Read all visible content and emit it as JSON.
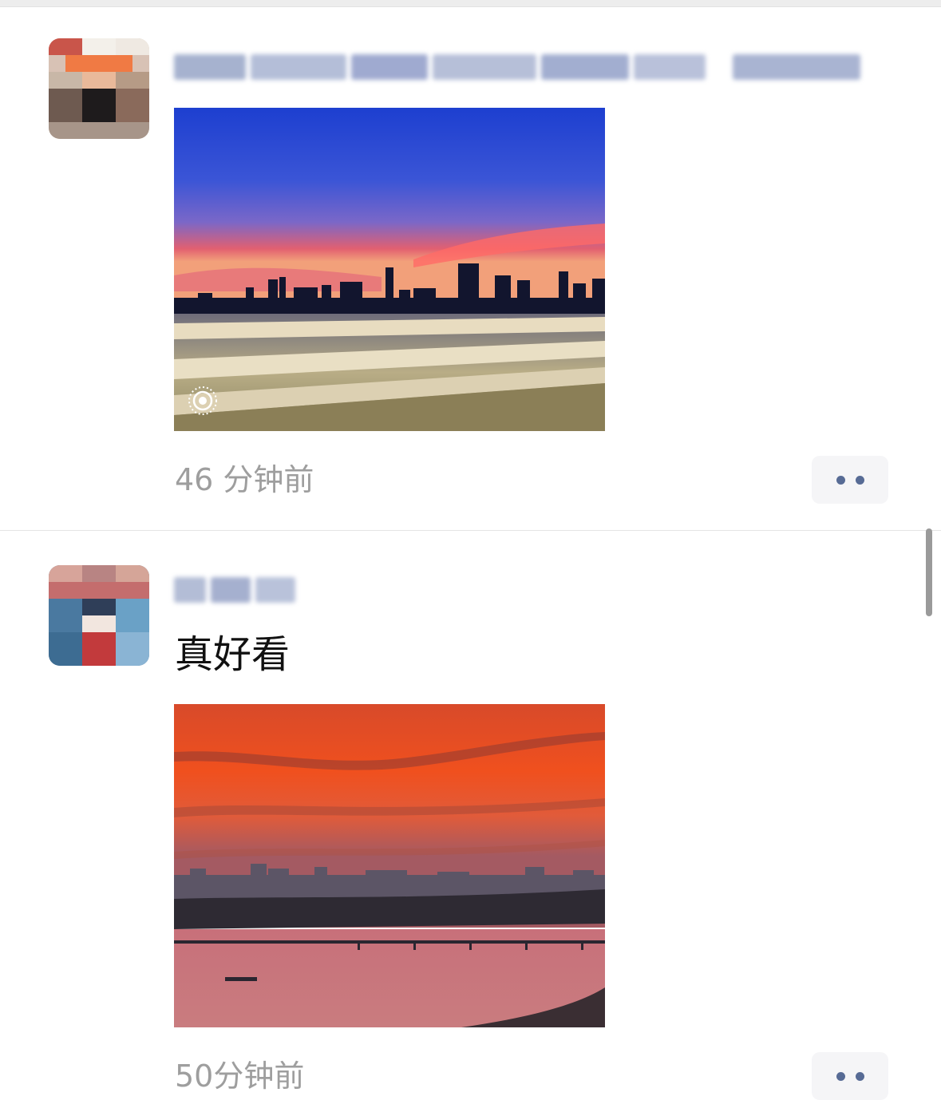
{
  "feed": {
    "posts": [
      {
        "caption": "",
        "photo_alt": "",
        "live_photo_icon": "live-photo-icon",
        "timestamp": "46 分钟前",
        "more_icon": "more-dots-icon"
      },
      {
        "caption": "真好看",
        "photo_alt": "",
        "timestamp": "50分钟前",
        "more_icon": "more-dots-icon"
      }
    ]
  },
  "colors": {
    "link_blue": "#576b95",
    "timestamp_gray": "#9e9e9e",
    "more_button_bg": "#f5f5f7",
    "divider": "#e5e5e5"
  }
}
